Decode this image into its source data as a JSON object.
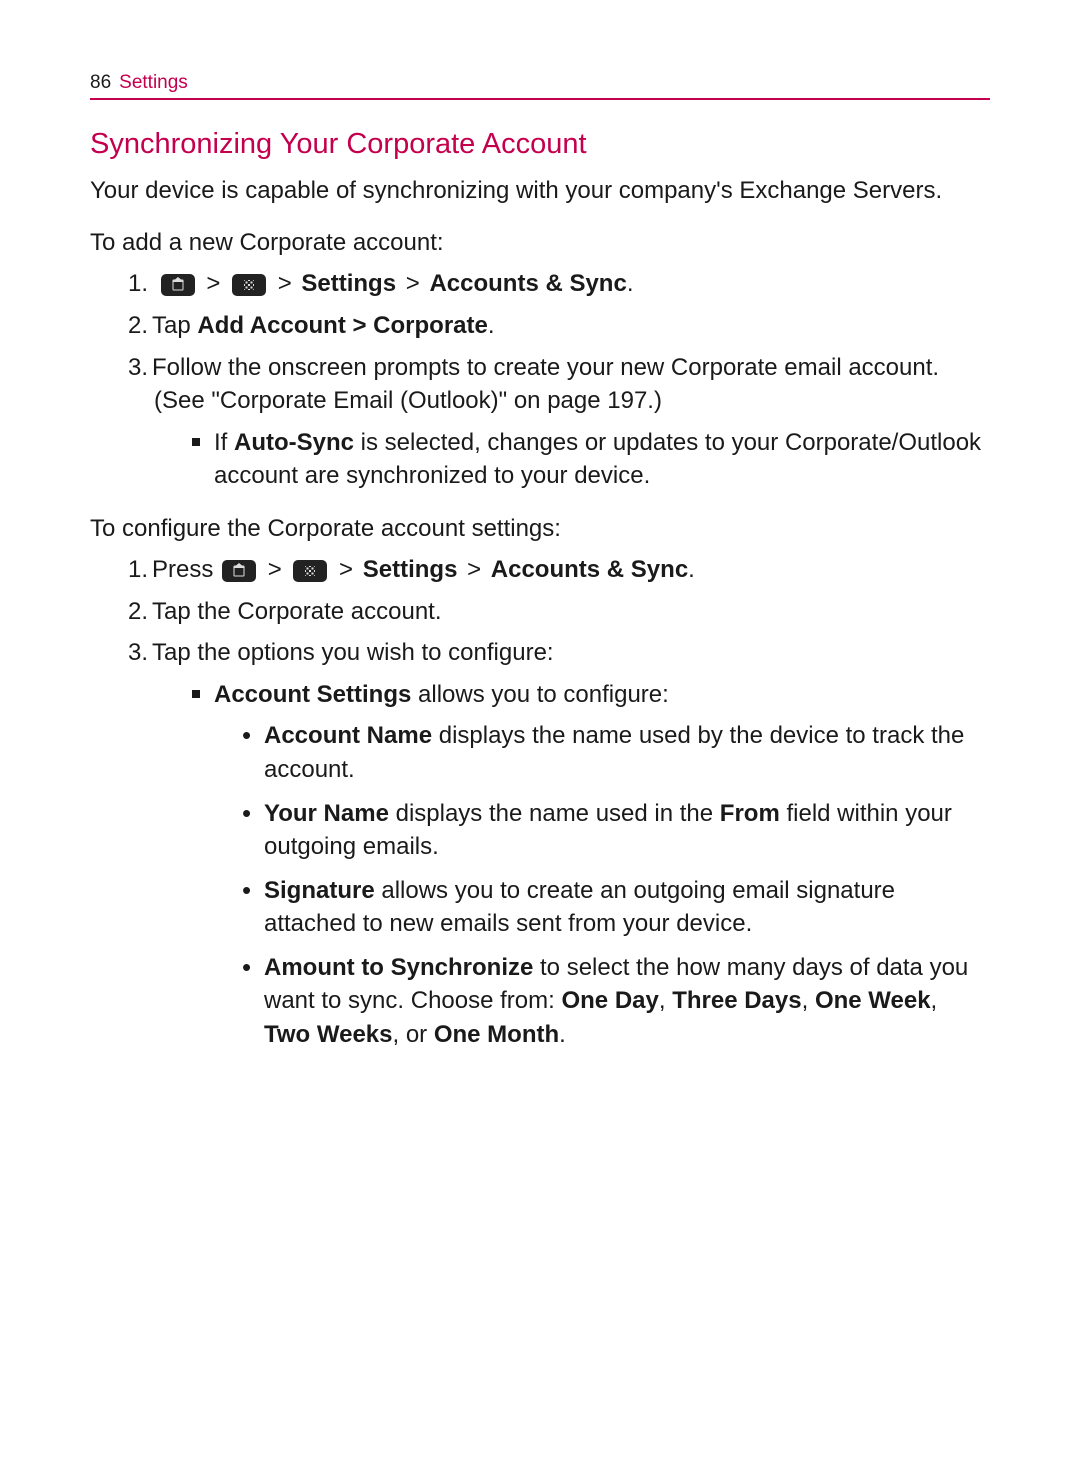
{
  "header": {
    "page_number": "86",
    "section": "Settings"
  },
  "title": "Synchronizing Your Corporate Account",
  "intro": "Your device is capable of synchronizing with your company's Exchange Servers.",
  "add_section": {
    "heading": "To add a new Corporate account:",
    "steps": {
      "s1": {
        "num": "1.",
        "gt1": ">",
        "gt2": ">",
        "settings": "Settings",
        "gt3": ">",
        "accounts_sync": "Accounts & Sync",
        "period": "."
      },
      "s2": {
        "num": "2.",
        "pre": "Tap ",
        "add_account": "Add Account",
        "gt": " > ",
        "corporate": "Corporate",
        "period": "."
      },
      "s3": {
        "num": "3.",
        "text": "Follow the onscreen prompts to create your new Corporate email account. (See \"Corporate Email (Outlook)\" on page 197.)",
        "sub": {
          "pre": "If ",
          "auto_sync": "Auto-Sync",
          "post": " is selected, changes or updates to your Corporate/Outlook account are synchronized to your device."
        }
      }
    }
  },
  "config_section": {
    "heading": "To configure the Corporate account settings:",
    "steps": {
      "s1": {
        "num": "1.",
        "pre": "Press ",
        "gt1": ">",
        "gt2": ">",
        "settings": "Settings",
        "gt3": ">",
        "accounts_sync": "Accounts & Sync",
        "period": "."
      },
      "s2": {
        "num": "2.",
        "text": "Tap the Corporate account."
      },
      "s3": {
        "num": "3.",
        "text": "Tap the options you wish to configure:",
        "account_settings": {
          "label": "Account Settings",
          "post": " allows you to configure:",
          "items": {
            "account_name": {
              "label": "Account Name",
              "post": " displays the name used by the device to track the account."
            },
            "your_name": {
              "label": "Your Name",
              "mid1": " displays the name used in the ",
              "from": "From",
              "mid2": " field within your outgoing emails."
            },
            "signature": {
              "label": "Signature",
              "post": " allows you to create an outgoing email signature attached to new emails sent from your device."
            },
            "amount": {
              "label": "Amount to Synchronize",
              "mid": " to select the how many days of data you want to sync. Choose from: ",
              "one_day": "One Day",
              "c1": ", ",
              "three_days": "Three Days",
              "c2": ", ",
              "one_week": "One Week",
              "c3": ", ",
              "two_weeks": "Two Weeks",
              "c4": ", or ",
              "one_month": "One Month",
              "period": "."
            }
          }
        }
      }
    }
  }
}
